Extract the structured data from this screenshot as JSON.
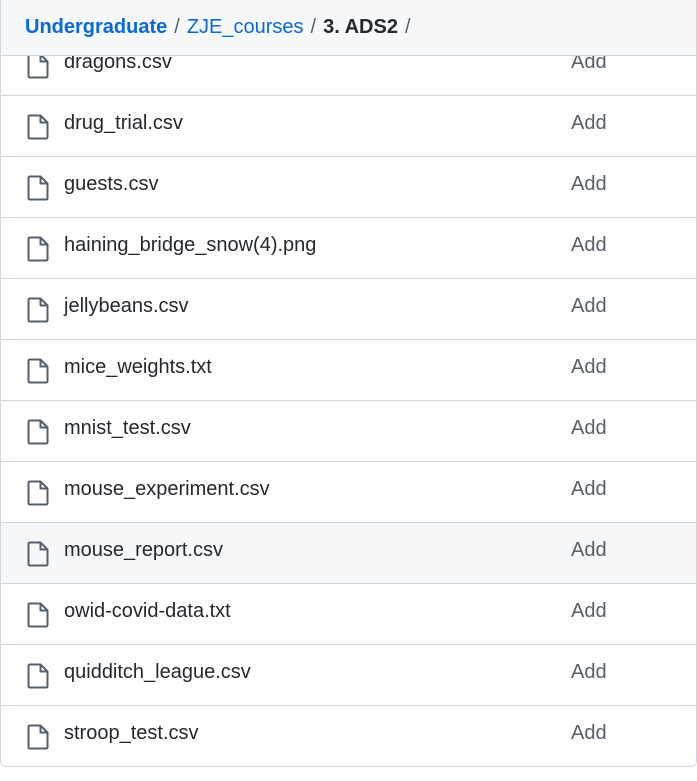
{
  "breadcrumb": {
    "root": "Undergraduate",
    "parent": "ZJE_courses",
    "current": "3. ADS2",
    "separator": "/"
  },
  "files": [
    {
      "name": "dragons.csv",
      "commit": "Add"
    },
    {
      "name": "drug_trial.csv",
      "commit": "Add"
    },
    {
      "name": "guests.csv",
      "commit": "Add"
    },
    {
      "name": "haining_bridge_snow(4).png",
      "commit": "Add"
    },
    {
      "name": "jellybeans.csv",
      "commit": "Add"
    },
    {
      "name": "mice_weights.txt",
      "commit": "Add"
    },
    {
      "name": "mnist_test.csv",
      "commit": "Add"
    },
    {
      "name": "mouse_experiment.csv",
      "commit": "Add"
    },
    {
      "name": "mouse_report.csv",
      "commit": "Add",
      "hovered": true
    },
    {
      "name": "owid-covid-data.txt",
      "commit": "Add"
    },
    {
      "name": "quidditch_league.csv",
      "commit": "Add"
    },
    {
      "name": "stroop_test.csv",
      "commit": "Add"
    }
  ],
  "icons": {
    "file": "file-icon"
  },
  "colors": {
    "link": "#0969da",
    "text": "#24292f",
    "muted": "#57606a",
    "hover_row": "#f6f8fa"
  }
}
